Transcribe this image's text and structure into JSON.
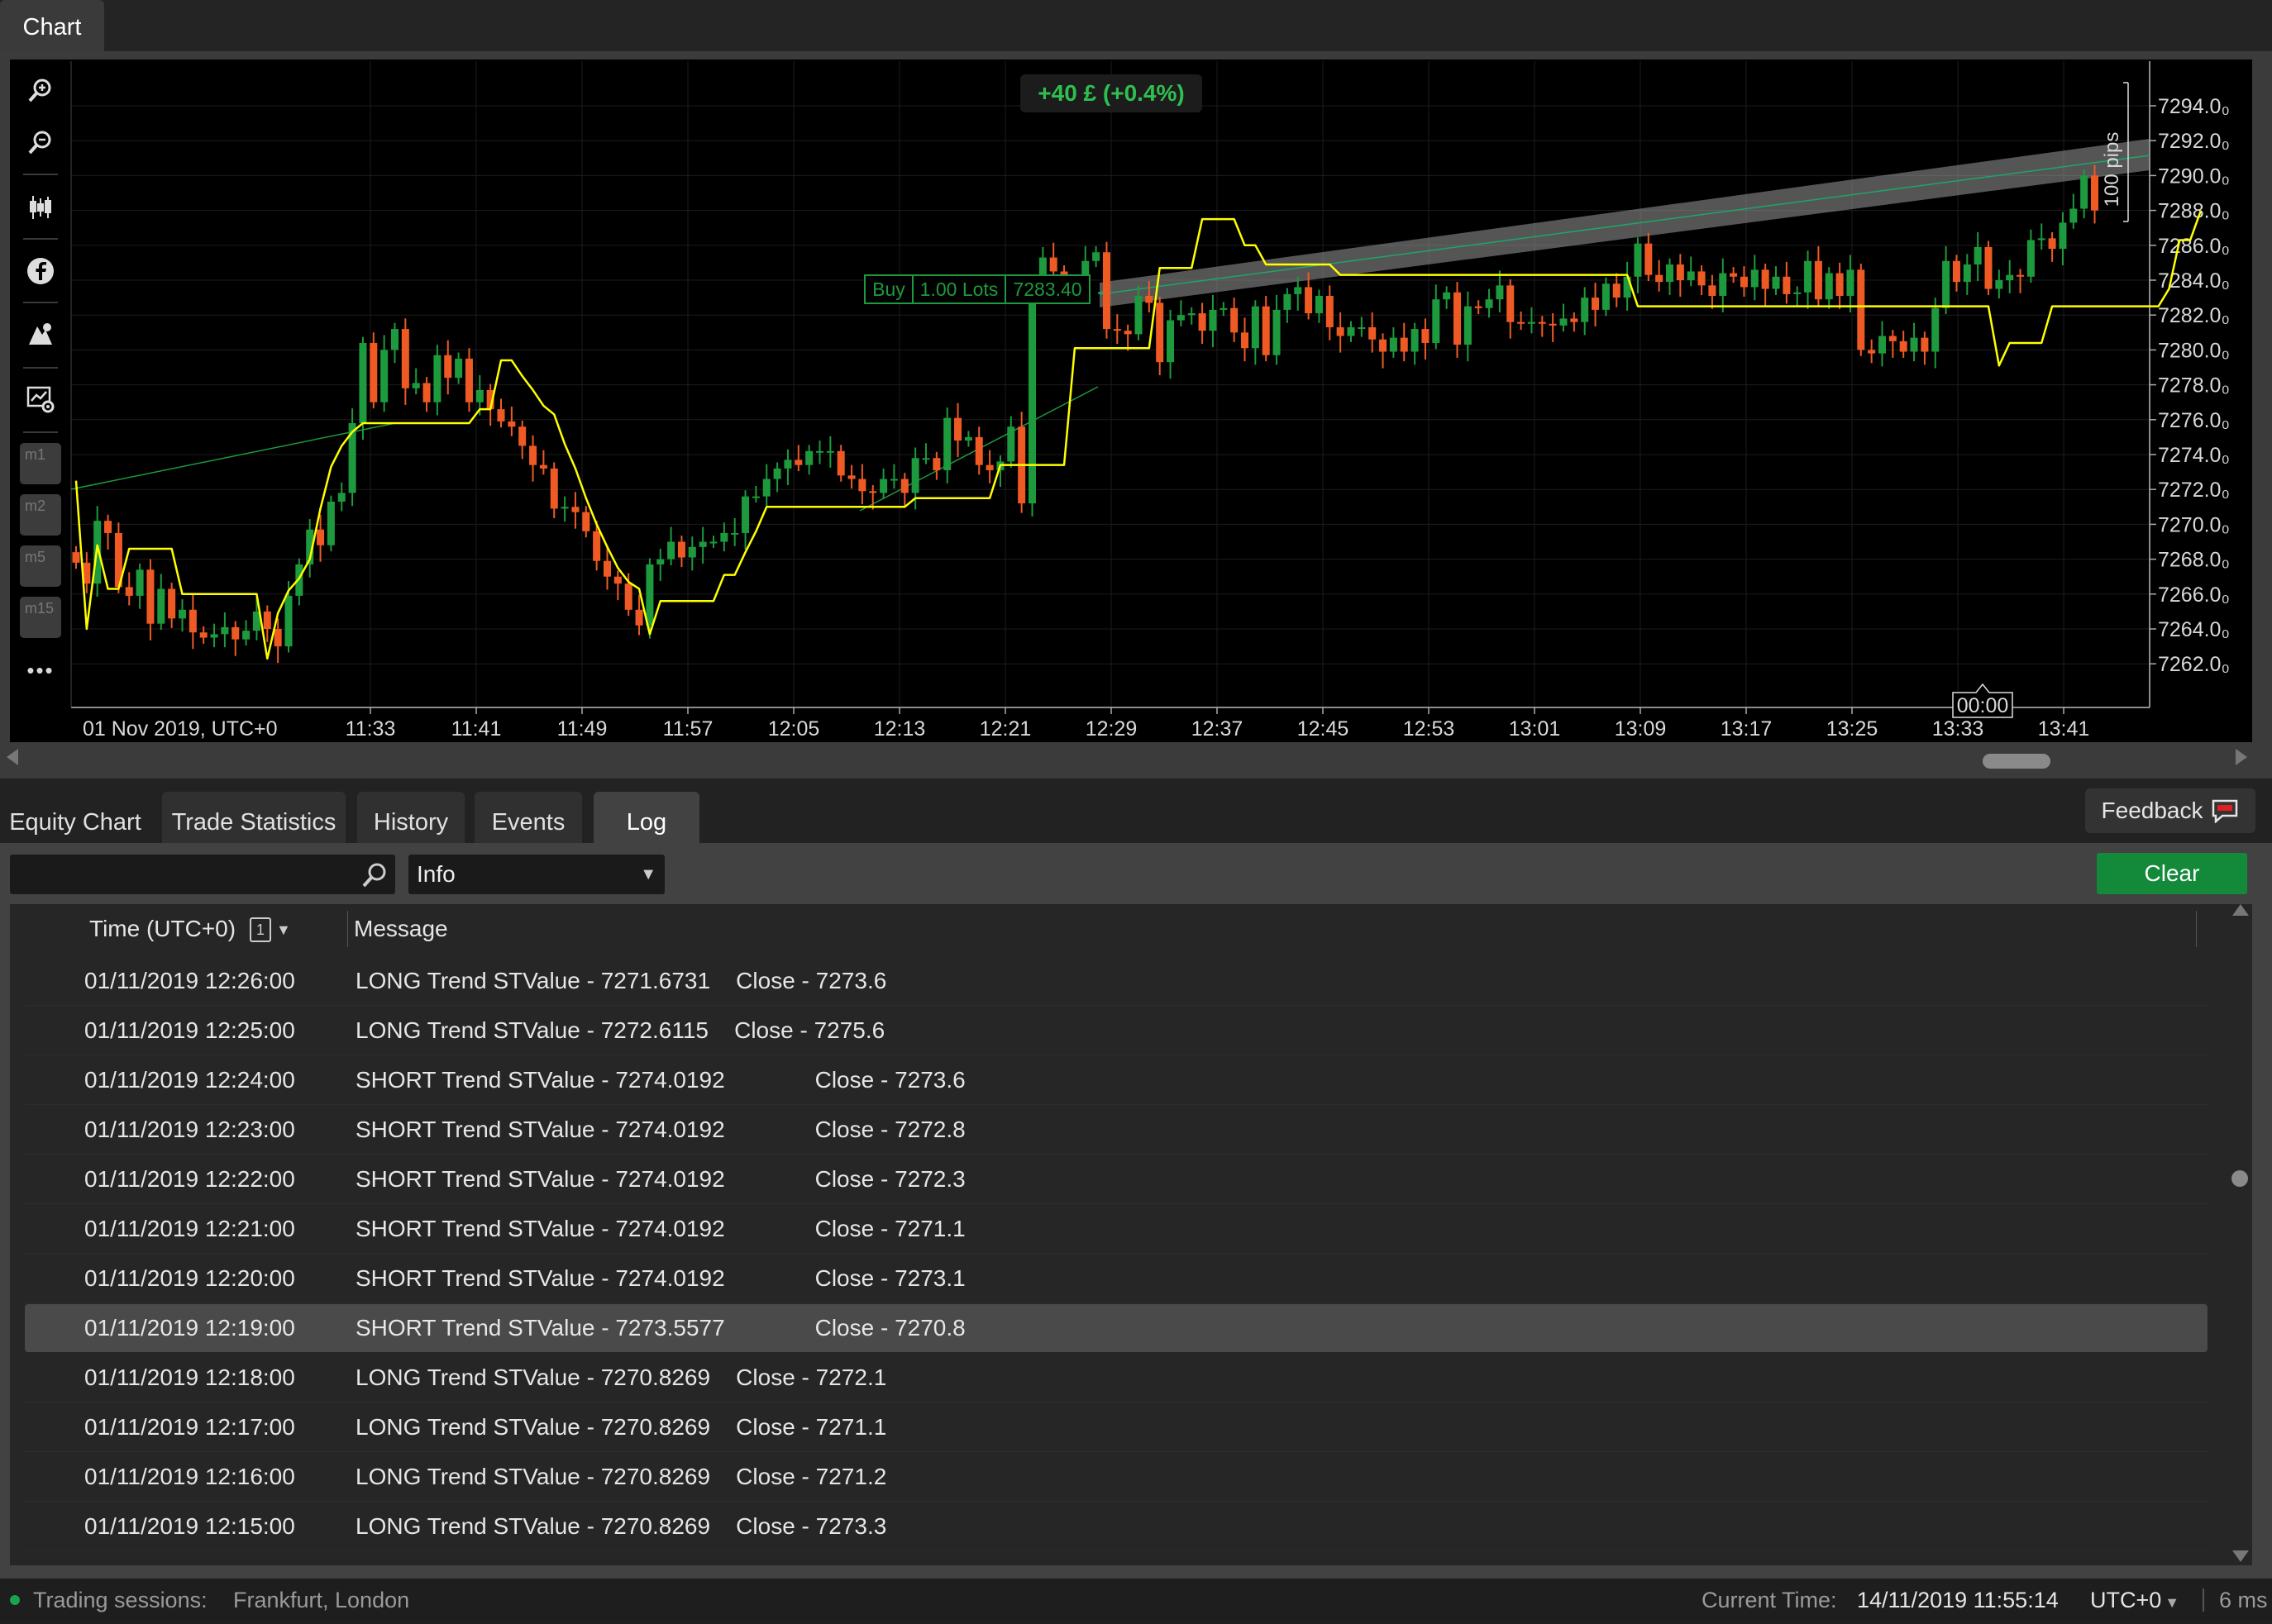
{
  "chart_tab": "Chart",
  "chart_toolbar": {
    "zoom_in": "zoom-in-icon",
    "zoom_out": "zoom-out-icon",
    "chart_type": "candlestick-icon",
    "social": "facebook-icon",
    "draw": "drawing-tools-icon",
    "settings": "chart-settings-icon",
    "timeframes": [
      "m1",
      "m2",
      "m5",
      "m15"
    ],
    "more": "•••"
  },
  "chart_data": {
    "type": "candlestick",
    "title": "",
    "ylim": [
      7260,
      7296
    ],
    "y_ticks": [
      "7294.0₀",
      "7292.0₀",
      "7290.0₀",
      "7288.0₀",
      "7286.0₀",
      "7284.0₀",
      "7282.0₀",
      "7280.0₀",
      "7278.0₀",
      "7276.0₀",
      "7274.0₀",
      "7272.0₀",
      "7270.0₀",
      "7268.0₀",
      "7266.0₀",
      "7264.0₀",
      "7262.0₀"
    ],
    "x_ticks": [
      "01 Nov 2019, UTC+0",
      "11:33",
      "11:41",
      "11:49",
      "11:57",
      "12:05",
      "12:13",
      "12:21",
      "12:29",
      "12:37",
      "12:45",
      "12:53",
      "13:01",
      "13:09",
      "13:17",
      "13:25",
      "13:33",
      "13:41"
    ],
    "closes": [
      7267.8,
      7266.6,
      7270.2,
      7269.5,
      7266.4,
      7265.9,
      7267.4,
      7264.3,
      7266.3,
      7264.6,
      7265.1,
      7263.8,
      7263.5,
      7263.7,
      7264.1,
      7263.4,
      7263.9,
      7265.0,
      7264.0,
      7263.0,
      7265.9,
      7267.7,
      7269.7,
      7268.8,
      7271.3,
      7271.8,
      7275.8,
      7280.4,
      7277.0,
      7280.0,
      7281.2,
      7277.8,
      7278.1,
      7277.0,
      7279.7,
      7278.4,
      7279.5,
      7277.0,
      7277.7,
      7276.6,
      7275.9,
      7275.6,
      7274.5,
      7273.4,
      7273.2,
      7270.9,
      7271.0,
      7270.7,
      7269.6,
      7267.9,
      7267.0,
      7266.6,
      7265.1,
      7264.2,
      7267.7,
      7268.0,
      7269.0,
      7268.1,
      7268.7,
      7269.0,
      7269.0,
      7269.5,
      7269.5,
      7271.6,
      7271.6,
      7272.6,
      7273.2,
      7273.7,
      7273.4,
      7274.2,
      7274.2,
      7274.2,
      7272.8,
      7272.6,
      7271.9,
      7271.8,
      7272.6,
      7272.6,
      7271.8,
      7273.8,
      7273.8,
      7273.1,
      7276.1,
      7274.8,
      7275.0,
      7273.4,
      7273.1,
      7273.6,
      7275.6,
      7271.2,
      7283.6,
      7285.3,
      7284.5,
      7283.5,
      7283.7,
      7285.1,
      7285.6,
      7281.2,
      7281.1,
      7280.9,
      7283.1,
      7282.7,
      7279.3,
      7281.7,
      7282.0,
      7282.1,
      7281.1,
      7282.3,
      7282.4,
      7281.0,
      7280.1,
      7282.5,
      7279.7,
      7282.3,
      7283.2,
      7283.6,
      7282.1,
      7283.1,
      7281.3,
      7280.8,
      7281.3,
      7281.3,
      7280.6,
      7279.9,
      7280.7,
      7279.9,
      7281.2,
      7280.4,
      7282.9,
      7283.3,
      7280.3,
      7282.5,
      7282.4,
      7282.9,
      7283.7,
      7281.6,
      7281.5,
      7281.6,
      7281.5,
      7281.4,
      7281.8,
      7281.6,
      7283.0,
      7282.3,
      7283.8,
      7283.0,
      7284.2,
      7286.1,
      7284.3,
      7283.9,
      7284.9,
      7284.0,
      7284.5,
      7283.7,
      7283.1,
      7284.4,
      7284.2,
      7283.6,
      7284.6,
      7283.5,
      7284.2,
      7283.2,
      7283.3,
      7285.1,
      7282.9,
      7284.4,
      7283.1,
      7284.6,
      7280.0,
      7279.8,
      7280.8,
      7280.5,
      7279.9,
      7280.7,
      7279.9,
      7282.4,
      7285.1,
      7283.9,
      7284.9,
      7285.9,
      7283.5,
      7284.0,
      7284.3,
      7284.2,
      7286.3,
      7286.4,
      7285.8,
      7287.3,
      7288.1,
      7290.0,
      7288.0
    ],
    "supertrend": [
      7272.5,
      7264.0,
      7268.8,
      7266.3,
      7266.3,
      7268.6,
      7268.6,
      7268.6,
      7268.6,
      7268.6,
      7266.0,
      7266.0,
      7266.0,
      7266.0,
      7266.0,
      7266.0,
      7266.0,
      7266.0,
      7262.3,
      7264.9,
      7266.2,
      7266.9,
      7268.0,
      7270.9,
      7273.3,
      7274.5,
      7275.3,
      7275.8,
      7275.8,
      7275.8,
      7275.8,
      7275.8,
      7275.8,
      7275.8,
      7275.8,
      7275.8,
      7275.8,
      7275.8,
      7276.6,
      7276.6,
      7279.4,
      7279.4,
      7278.5,
      7277.7,
      7276.8,
      7276.3,
      7274.6,
      7273.2,
      7271.5,
      7270.0,
      7268.7,
      7267.5,
      7266.7,
      7266.3,
      7263.7,
      7265.6,
      7265.6,
      7265.6,
      7265.6,
      7265.6,
      7265.6,
      7267.1,
      7267.1,
      7268.4,
      7269.6,
      7271.0,
      7271.0,
      7271.0,
      7271.0,
      7271.0,
      7271.0,
      7271.0,
      7271.0,
      7271.0,
      7271.0,
      7271.0,
      7271.0,
      7271.0,
      7271.0,
      7271.5,
      7271.5,
      7271.5,
      7271.5,
      7271.5,
      7271.5,
      7271.5,
      7271.5,
      7273.4,
      7273.4,
      7273.4,
      7273.4,
      7273.4,
      7273.4,
      7273.4,
      7280.1,
      7280.1,
      7280.1,
      7280.1,
      7280.1,
      7280.1,
      7280.1,
      7280.1,
      7284.7,
      7284.7,
      7284.7,
      7284.7,
      7287.5,
      7287.5,
      7287.5,
      7287.5,
      7286.0,
      7286.0,
      7284.9,
      7284.9,
      7284.9,
      7284.9,
      7284.9,
      7284.9,
      7284.9,
      7284.3,
      7284.3,
      7284.3,
      7284.3,
      7284.3,
      7284.3,
      7284.3,
      7284.3,
      7284.3,
      7284.3,
      7284.3,
      7284.3,
      7284.3,
      7284.3,
      7284.3,
      7284.3,
      7284.3,
      7284.3,
      7284.3,
      7284.3,
      7284.3,
      7284.3,
      7284.3,
      7284.3,
      7284.3,
      7284.3,
      7284.3,
      7284.3,
      7282.5,
      7282.5,
      7282.5,
      7282.5,
      7282.5,
      7282.5,
      7282.5,
      7282.5,
      7282.5,
      7282.5,
      7282.5,
      7282.5,
      7282.5,
      7282.5,
      7282.5,
      7282.5,
      7282.5,
      7282.5,
      7282.5,
      7282.5,
      7282.5,
      7282.5,
      7282.5,
      7282.5,
      7282.5,
      7282.5,
      7282.5,
      7282.5,
      7282.5,
      7282.5,
      7282.5,
      7282.5,
      7282.5,
      7282.5,
      7279.1,
      7280.4,
      7280.4,
      7280.4,
      7280.4,
      7282.5,
      7282.5,
      7282.5,
      7282.5,
      7282.5,
      7282.5,
      7282.5,
      7282.5,
      7282.5,
      7282.5,
      7282.5,
      7283.5,
      7286.3,
      7286.3,
      7288.0
    ],
    "trade_label": {
      "side": "Buy",
      "lots": "1.00 Lots",
      "price": "7283.40"
    },
    "pnl": "+40 £ (+0.4%)",
    "pips_label": "100 pips",
    "cursor_time": "00:00",
    "colors": {
      "up": "#1d9a3e",
      "down": "#ef5a24",
      "supertrend": "#ffff00",
      "bg": "#000000",
      "grid": "#1c1c1c"
    }
  },
  "bottom_tabs": [
    "Equity Chart",
    "Trade Statistics",
    "History",
    "Events",
    "Log"
  ],
  "active_tab": "Log",
  "feedback_label": "Feedback",
  "log_filter": {
    "search_value": "",
    "level": "Info"
  },
  "clear_label": "Clear",
  "log_table": {
    "headers": {
      "time": "Time (UTC+0)",
      "sort_badge": "1",
      "message": "Message"
    },
    "rows": [
      {
        "time": "01/11/2019 12:26:00",
        "message": "LONG Trend STValue - 7271.6731    Close - 7273.6"
      },
      {
        "time": "01/11/2019 12:25:00",
        "message": "LONG Trend STValue - 7272.6115    Close - 7275.6"
      },
      {
        "time": "01/11/2019 12:24:00",
        "message": "SHORT Trend STValue - 7274.0192              Close - 7273.6"
      },
      {
        "time": "01/11/2019 12:23:00",
        "message": "SHORT Trend STValue - 7274.0192              Close - 7272.8"
      },
      {
        "time": "01/11/2019 12:22:00",
        "message": "SHORT Trend STValue - 7274.0192              Close - 7272.3"
      },
      {
        "time": "01/11/2019 12:21:00",
        "message": "SHORT Trend STValue - 7274.0192              Close - 7271.1"
      },
      {
        "time": "01/11/2019 12:20:00",
        "message": "SHORT Trend STValue - 7274.0192              Close - 7273.1"
      },
      {
        "time": "01/11/2019 12:19:00",
        "message": "SHORT Trend STValue - 7273.5577              Close - 7270.8",
        "selected": true
      },
      {
        "time": "01/11/2019 12:18:00",
        "message": "LONG Trend STValue - 7270.8269    Close - 7272.1"
      },
      {
        "time": "01/11/2019 12:17:00",
        "message": "LONG Trend STValue - 7270.8269    Close - 7271.1"
      },
      {
        "time": "01/11/2019 12:16:00",
        "message": "LONG Trend STValue - 7270.8269    Close - 7271.2"
      },
      {
        "time": "01/11/2019 12:15:00",
        "message": "LONG Trend STValue - 7270.8269    Close - 7273.3"
      }
    ]
  },
  "status_bar": {
    "sessions_label": "Trading sessions:",
    "sessions_value": "Frankfurt, London",
    "current_time_label": "Current Time:",
    "current_time_value": "14/11/2019 11:55:14",
    "timezone": "UTC+0",
    "latency": "6 ms"
  }
}
